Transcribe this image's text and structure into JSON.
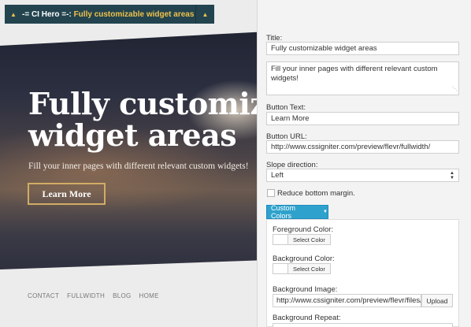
{
  "preview": {
    "hero_title_line1": "Fully customizable",
    "hero_title_line2": "widget areas",
    "hero_subtitle": "Fill your inner pages with different relevant custom widgets!",
    "hero_button": "Learn More",
    "footer_links": [
      "CONTACT",
      "FULLWIDTH",
      "BLOG",
      "HOME"
    ]
  },
  "panel": {
    "header_prefix": "-= CI Hero =-:",
    "header_title": "Fully customizable widget areas",
    "title_label": "Title:",
    "title_value": "Fully customizable widget areas",
    "text_value": "Fill your inner pages with different relevant custom widgets!",
    "button_text_label": "Button Text:",
    "button_text_value": "Learn More",
    "button_url_label": "Button URL:",
    "button_url_value": "http://www.cssigniter.com/preview/flevr/fullwidth/",
    "slope_label": "Slope direction:",
    "slope_value": "Left",
    "reduce_margin_label": "Reduce bottom margin.",
    "reduce_margin_checked": false,
    "custom_colors_label": "Custom Colors",
    "foreground_label": "Foreground Color:",
    "background_label": "Background Color:",
    "select_color_label": "Select Color",
    "bg_image_label": "Background Image:",
    "bg_image_value": "http://www.cssigniter.com/preview/flevr/files/",
    "upload_label": "Upload",
    "bg_repeat_label": "Background Repeat:"
  },
  "icons": {
    "collapse": "triangle-up-icon",
    "toggle": "triangle-up-icon",
    "dropdown": "triangle-down-icon",
    "select": "up-down-arrows-icon"
  },
  "colors": {
    "header_bg": "#23444f",
    "header_accent": "#f0c14b",
    "button_border": "#d1ac64",
    "custom_colors_button": "#2ea2cc"
  }
}
